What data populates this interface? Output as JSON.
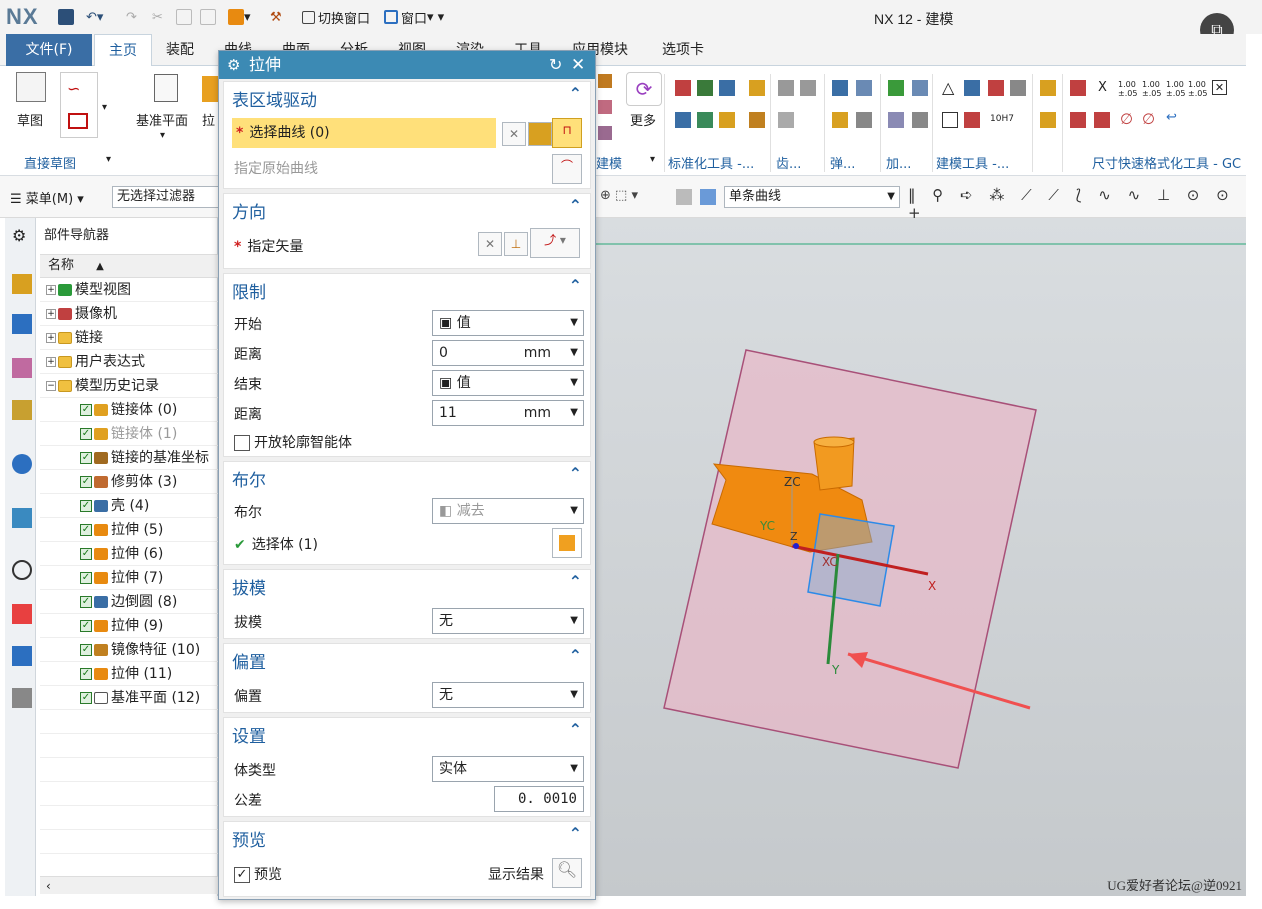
{
  "app": {
    "logo": "NX",
    "title": "NX 12 - 建模",
    "switch_window": "切换窗口",
    "window_menu": "窗口"
  },
  "tabs": [
    "文件(F)",
    "主页",
    "装配",
    "曲线",
    "曲面",
    "分析",
    "视图",
    "渲染",
    "工具",
    "应用模块",
    "选项卡"
  ],
  "ribbon": {
    "sketch": "草图",
    "datum_plane": "基准平面",
    "extrude_short": "拉",
    "more": "更多",
    "groups": [
      "直接草图",
      "建模",
      "标准化工具 -...",
      "齿...",
      "弹...",
      "加...",
      "建模工具 -...",
      "尺寸快速格式化工具 - GC"
    ],
    "dim_labels": [
      "1.00 ±.05",
      "1.00 ±.05",
      "1.00 ±.05",
      "1.00 ±.05"
    ],
    "fit_label": "10H7",
    "x_label": "X"
  },
  "selbar": {
    "menu": "菜单(M)",
    "filter": "无选择过滤器",
    "curve_rule": "单条曲线"
  },
  "navigator": {
    "title": "部件导航器",
    "column": "名称",
    "items": [
      {
        "label": "模型视图",
        "kind": "top",
        "icon": "model-views-icon"
      },
      {
        "label": "摄像机",
        "kind": "top",
        "icon": "camera-icon"
      },
      {
        "label": "链接",
        "kind": "top",
        "icon": "folder-icon"
      },
      {
        "label": "用户表达式",
        "kind": "top",
        "icon": "folder-icon"
      },
      {
        "label": "模型历史记录",
        "kind": "top-open",
        "icon": "folder-icon"
      },
      {
        "label": "链接体 (0)",
        "kind": "feat",
        "icon": "linked-body-icon"
      },
      {
        "label": "链接体 (1)",
        "kind": "feat-dim",
        "icon": "linked-body-icon"
      },
      {
        "label": "链接的基准坐标",
        "kind": "feat",
        "icon": "datum-csys-icon"
      },
      {
        "label": "修剪体 (3)",
        "kind": "feat",
        "icon": "trim-body-icon"
      },
      {
        "label": "壳 (4)",
        "kind": "feat",
        "icon": "shell-icon"
      },
      {
        "label": "拉伸 (5)",
        "kind": "feat",
        "icon": "extrude-icon"
      },
      {
        "label": "拉伸 (6)",
        "kind": "feat",
        "icon": "extrude-icon"
      },
      {
        "label": "拉伸 (7)",
        "kind": "feat",
        "icon": "extrude-icon"
      },
      {
        "label": "边倒圆 (8)",
        "kind": "feat",
        "icon": "edge-blend-icon"
      },
      {
        "label": "拉伸 (9)",
        "kind": "feat",
        "icon": "extrude-icon"
      },
      {
        "label": "镜像特征 (10)",
        "kind": "feat",
        "icon": "mirror-feature-icon"
      },
      {
        "label": "拉伸 (11)",
        "kind": "feat",
        "icon": "extrude-icon"
      },
      {
        "label": "基准平面 (12)",
        "kind": "feat",
        "icon": "datum-plane-icon"
      }
    ]
  },
  "dialog": {
    "title": "拉伸",
    "section_curve": {
      "title": "表区域驱动",
      "select_curve": "选择曲线 (0)",
      "original_curve": "指定原始曲线"
    },
    "direction": {
      "title": "方向",
      "vector": "指定矢量"
    },
    "limits": {
      "title": "限制",
      "start_label": "开始",
      "start_value": "值",
      "distance1_label": "距离",
      "distance1_value": "0",
      "distance1_unit": "mm",
      "end_label": "结束",
      "end_value": "值",
      "distance2_label": "距离",
      "distance2_value": "11",
      "distance2_unit": "mm",
      "open_profile": "开放轮廓智能体"
    },
    "boolean": {
      "title": "布尔",
      "label": "布尔",
      "value": "减去",
      "select_body": "选择体 (1)"
    },
    "draft": {
      "title": "拔模",
      "label": "拔模",
      "value": "无"
    },
    "offset": {
      "title": "偏置",
      "label": "偏置",
      "value": "无"
    },
    "settings": {
      "title": "设置",
      "body_type_label": "体类型",
      "body_type_value": "实体",
      "tolerance_label": "公差",
      "tolerance_value": "0. 0010"
    },
    "preview": {
      "title": "预览",
      "preview_label": "预览",
      "show_result": "显示结果"
    }
  },
  "viewport": {
    "axis_labels": {
      "zc": "ZC",
      "yc": "YC",
      "xc": "XC",
      "x": "X",
      "y": "Y",
      "z": "Z"
    },
    "watermark": "UG爱好者论坛@逆0921"
  },
  "colors": {
    "accent": "#1f5f9f",
    "dialog_header": "#3c8ab4",
    "required_star": "#d02020",
    "selection_highlight": "#ffe07a",
    "part_orange": "#f08a10",
    "datum_plane": "#e8b8c8",
    "arrow_red": "#ee4444"
  }
}
